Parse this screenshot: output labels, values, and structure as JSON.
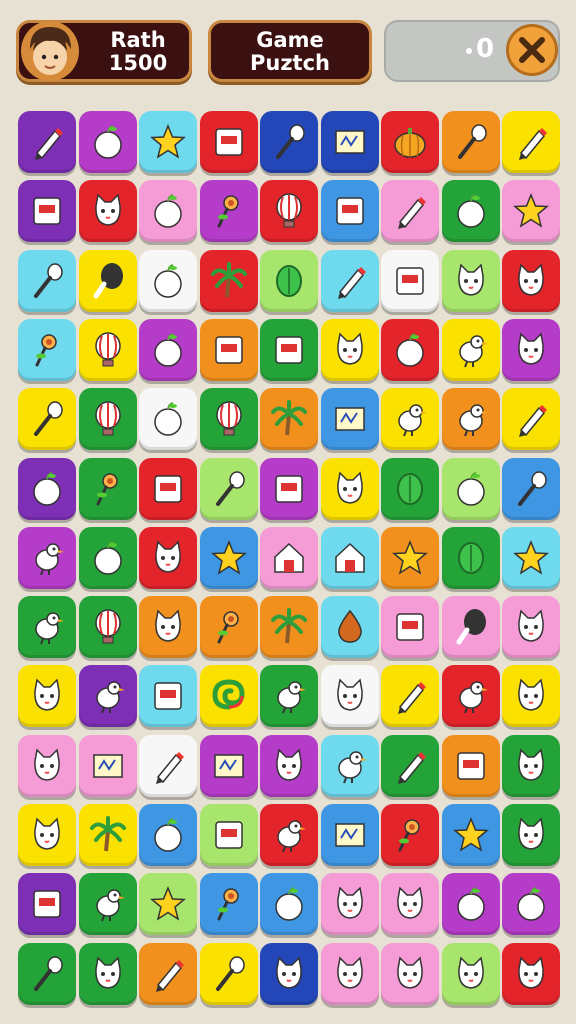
{
  "player": {
    "name": "Rath",
    "score": "1500"
  },
  "game_title": {
    "line1": "Game",
    "line2": "Puztch"
  },
  "score_display": {
    "value": "0"
  },
  "colors": {
    "purple": "#7d2fb5",
    "magenta": "#b43cc8",
    "lightblue": "#6fd9ee",
    "red": "#e3242b",
    "blue": "#2347b8",
    "orange": "#f2901e",
    "yellow": "#fbe100",
    "pink": "#f59bd6",
    "green": "#24a339",
    "lime": "#a8e56c",
    "white": "#f7f7f7",
    "skyblue": "#3f97e4"
  },
  "board": {
    "rows": [
      [
        {
          "c": "purple",
          "i": "pen"
        },
        {
          "c": "magenta",
          "i": "fruit"
        },
        {
          "c": "lightblue",
          "i": "star"
        },
        {
          "c": "red",
          "i": "box"
        },
        {
          "c": "blue",
          "i": "spoon"
        },
        {
          "c": "blue",
          "i": "sign"
        },
        {
          "c": "red",
          "i": "pumpkin"
        },
        {
          "c": "orange",
          "i": "spoon"
        },
        {
          "c": "yellow",
          "i": "pen"
        }
      ],
      [
        {
          "c": "purple",
          "i": "box"
        },
        {
          "c": "red",
          "i": "cat"
        },
        {
          "c": "pink",
          "i": "fruit"
        },
        {
          "c": "magenta",
          "i": "flower"
        },
        {
          "c": "red",
          "i": "balloon"
        },
        {
          "c": "skyblue",
          "i": "box"
        },
        {
          "c": "pink",
          "i": "pen"
        },
        {
          "c": "green",
          "i": "fruit"
        },
        {
          "c": "pink",
          "i": "star"
        }
      ],
      [
        {
          "c": "lightblue",
          "i": "spoon"
        },
        {
          "c": "yellow",
          "i": "drumstick"
        },
        {
          "c": "white",
          "i": "fruit"
        },
        {
          "c": "red",
          "i": "palm"
        },
        {
          "c": "lime",
          "i": "leaf"
        },
        {
          "c": "lightblue",
          "i": "pen"
        },
        {
          "c": "white",
          "i": "box"
        },
        {
          "c": "lime",
          "i": "cat"
        },
        {
          "c": "red",
          "i": "cat"
        }
      ],
      [
        {
          "c": "lightblue",
          "i": "flower"
        },
        {
          "c": "yellow",
          "i": "balloon"
        },
        {
          "c": "magenta",
          "i": "fruit"
        },
        {
          "c": "orange",
          "i": "box"
        },
        {
          "c": "green",
          "i": "box"
        },
        {
          "c": "yellow",
          "i": "cat"
        },
        {
          "c": "red",
          "i": "fruit"
        },
        {
          "c": "yellow",
          "i": "bird"
        },
        {
          "c": "magenta",
          "i": "cat"
        }
      ],
      [
        {
          "c": "yellow",
          "i": "spoon"
        },
        {
          "c": "green",
          "i": "balloon"
        },
        {
          "c": "white",
          "i": "fruit"
        },
        {
          "c": "green",
          "i": "balloon"
        },
        {
          "c": "orange",
          "i": "palm"
        },
        {
          "c": "skyblue",
          "i": "sign"
        },
        {
          "c": "yellow",
          "i": "bird"
        },
        {
          "c": "orange",
          "i": "bird"
        },
        {
          "c": "yellow",
          "i": "pen"
        }
      ],
      [
        {
          "c": "purple",
          "i": "fruit"
        },
        {
          "c": "green",
          "i": "flower"
        },
        {
          "c": "red",
          "i": "box"
        },
        {
          "c": "lime",
          "i": "spoon"
        },
        {
          "c": "magenta",
          "i": "box"
        },
        {
          "c": "yellow",
          "i": "cat"
        },
        {
          "c": "green",
          "i": "leaf"
        },
        {
          "c": "lime",
          "i": "fruit"
        },
        {
          "c": "skyblue",
          "i": "spoon"
        }
      ],
      [
        {
          "c": "magenta",
          "i": "bird"
        },
        {
          "c": "green",
          "i": "fruit"
        },
        {
          "c": "red",
          "i": "cat"
        },
        {
          "c": "skyblue",
          "i": "star"
        },
        {
          "c": "pink",
          "i": "house"
        },
        {
          "c": "lightblue",
          "i": "house"
        },
        {
          "c": "orange",
          "i": "star"
        },
        {
          "c": "green",
          "i": "leaf"
        },
        {
          "c": "lightblue",
          "i": "star"
        }
      ],
      [
        {
          "c": "green",
          "i": "bird"
        },
        {
          "c": "green",
          "i": "balloon"
        },
        {
          "c": "orange",
          "i": "cat"
        },
        {
          "c": "orange",
          "i": "flower"
        },
        {
          "c": "orange",
          "i": "palm"
        },
        {
          "c": "lightblue",
          "i": "drop"
        },
        {
          "c": "pink",
          "i": "box"
        },
        {
          "c": "pink",
          "i": "drumstick"
        },
        {
          "c": "pink",
          "i": "cat"
        }
      ],
      [
        {
          "c": "yellow",
          "i": "cat"
        },
        {
          "c": "purple",
          "i": "bird"
        },
        {
          "c": "lightblue",
          "i": "box"
        },
        {
          "c": "yellow",
          "i": "swirl"
        },
        {
          "c": "green",
          "i": "bird"
        },
        {
          "c": "white",
          "i": "cat"
        },
        {
          "c": "yellow",
          "i": "pen"
        },
        {
          "c": "red",
          "i": "bird"
        },
        {
          "c": "yellow",
          "i": "cat"
        }
      ],
      [
        {
          "c": "pink",
          "i": "cat"
        },
        {
          "c": "pink",
          "i": "sign"
        },
        {
          "c": "white",
          "i": "pen"
        },
        {
          "c": "magenta",
          "i": "sign"
        },
        {
          "c": "magenta",
          "i": "cat"
        },
        {
          "c": "lightblue",
          "i": "bird"
        },
        {
          "c": "green",
          "i": "pen"
        },
        {
          "c": "orange",
          "i": "box"
        },
        {
          "c": "green",
          "i": "cat"
        }
      ],
      [
        {
          "c": "yellow",
          "i": "cat"
        },
        {
          "c": "yellow",
          "i": "palm"
        },
        {
          "c": "skyblue",
          "i": "fruit"
        },
        {
          "c": "lime",
          "i": "box"
        },
        {
          "c": "red",
          "i": "bird"
        },
        {
          "c": "skyblue",
          "i": "sign"
        },
        {
          "c": "red",
          "i": "flower"
        },
        {
          "c": "skyblue",
          "i": "star"
        },
        {
          "c": "green",
          "i": "cat"
        }
      ],
      [
        {
          "c": "purple",
          "i": "box"
        },
        {
          "c": "green",
          "i": "bird"
        },
        {
          "c": "lime",
          "i": "star"
        },
        {
          "c": "skyblue",
          "i": "flower"
        },
        {
          "c": "skyblue",
          "i": "fruit"
        },
        {
          "c": "pink",
          "i": "cat"
        },
        {
          "c": "pink",
          "i": "cat"
        },
        {
          "c": "magenta",
          "i": "fruit"
        },
        {
          "c": "magenta",
          "i": "fruit"
        }
      ],
      [
        {
          "c": "green",
          "i": "spoon"
        },
        {
          "c": "green",
          "i": "cat"
        },
        {
          "c": "orange",
          "i": "pen"
        },
        {
          "c": "yellow",
          "i": "spoon"
        },
        {
          "c": "blue",
          "i": "cat"
        },
        {
          "c": "pink",
          "i": "cat"
        },
        {
          "c": "pink",
          "i": "cat"
        },
        {
          "c": "lime",
          "i": "cat"
        },
        {
          "c": "red",
          "i": "cat"
        }
      ]
    ]
  }
}
